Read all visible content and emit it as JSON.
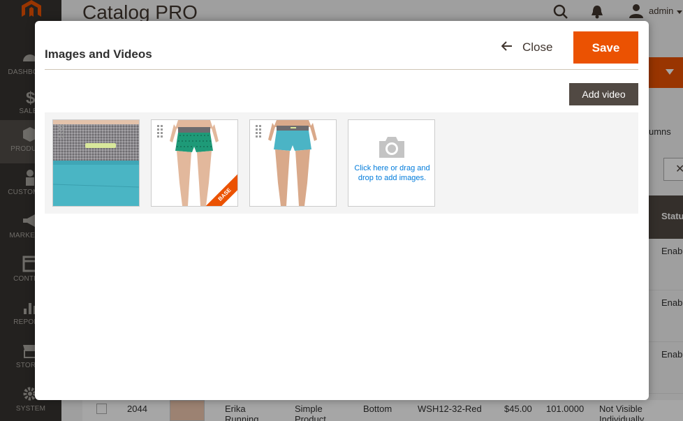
{
  "page": {
    "title": "Catalog PRO"
  },
  "header": {
    "user_name": "admin"
  },
  "sidebar": {
    "items": [
      {
        "label": "DASHBOARD",
        "icon": "dashboard-icon"
      },
      {
        "label": "SALES",
        "icon": "dollar-icon"
      },
      {
        "label": "PRODUCTS",
        "icon": "cube-icon"
      },
      {
        "label": "CUSTOMERS",
        "icon": "person-icon"
      },
      {
        "label": "MARKETING",
        "icon": "megaphone-icon"
      },
      {
        "label": "CONTENT",
        "icon": "layout-icon"
      },
      {
        "label": "REPORTS",
        "icon": "bar-chart-icon"
      },
      {
        "label": "STORES",
        "icon": "store-icon"
      },
      {
        "label": "SYSTEM",
        "icon": "gear-icon"
      }
    ]
  },
  "background": {
    "columns_label": "umns",
    "status_header": "Statu",
    "rows": [
      "Enab",
      "Enab",
      "Enab"
    ],
    "bottom_row": {
      "id": "2044",
      "name": "Erika Running",
      "type": "Simple Product",
      "attribute_set": "Bottom",
      "sku": "WSH12-32-Red",
      "price": "$45.00",
      "quantity": "101.0000",
      "visibility": "Not Visible Individually"
    }
  },
  "modal": {
    "title": "Images and Videos",
    "close_label": "Close",
    "save_label": "Save",
    "add_video_label": "Add video",
    "images": [
      {
        "alt": "shorts waistband detail",
        "role": ""
      },
      {
        "alt": "green shorts front",
        "role": "BASE"
      },
      {
        "alt": "blue shorts back",
        "role": ""
      }
    ],
    "upload_text": "Click here or drag and drop to add images."
  },
  "colors": {
    "accent": "#eb5202",
    "sidebar": "#373330",
    "dark_button": "#514943",
    "link": "#007bdb"
  }
}
